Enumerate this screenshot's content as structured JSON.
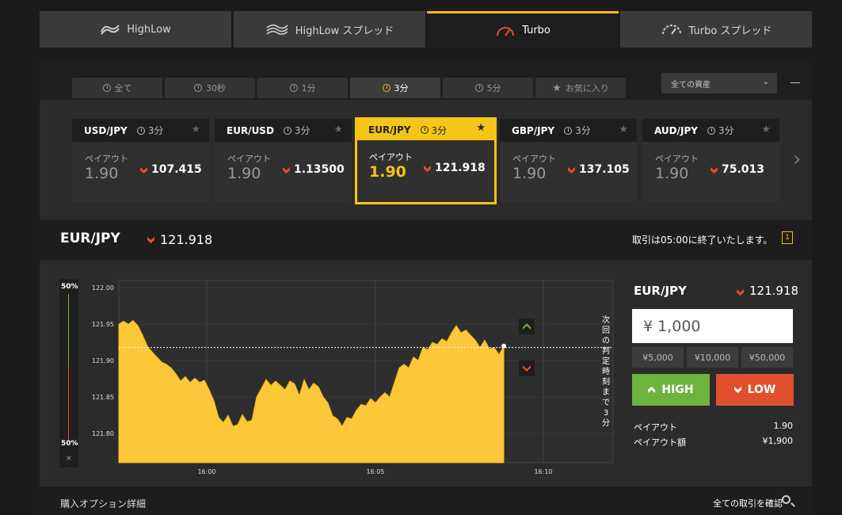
{
  "topnav": {
    "tabs": [
      {
        "label": "HighLow",
        "icon": "highlow-icon"
      },
      {
        "label": "HighLow スプレッド",
        "icon": "highlow-spread-icon"
      },
      {
        "label": "Turbo",
        "icon": "turbo-gauge-icon",
        "active": true
      },
      {
        "label": "Turbo スプレッド",
        "icon": "turbo-spread-gauge-icon"
      }
    ]
  },
  "filters": {
    "tabs": [
      {
        "label": "全て"
      },
      {
        "label": "30秒"
      },
      {
        "label": "1分"
      },
      {
        "label": "3分",
        "active": true
      },
      {
        "label": "5分"
      },
      {
        "label": "お気に入り"
      }
    ],
    "asset_select": "全ての資産"
  },
  "cards": [
    {
      "pair": "USD/JPY",
      "duration": "3分",
      "payout_label": "ペイアウト",
      "payout": "1.90",
      "price": "107.415"
    },
    {
      "pair": "EUR/USD",
      "duration": "3分",
      "payout_label": "ペイアウト",
      "payout": "1.90",
      "price": "1.13500"
    },
    {
      "pair": "EUR/JPY",
      "duration": "3分",
      "payout_label": "ペイアウト",
      "payout": "1.90",
      "price": "121.918"
    },
    {
      "pair": "GBP/JPY",
      "duration": "3分",
      "payout_label": "ペイアウト",
      "payout": "1.90",
      "price": "137.105"
    },
    {
      "pair": "AUD/JPY",
      "duration": "3分",
      "payout_label": "ペイアウト",
      "payout": "1.90",
      "price": "75.013"
    }
  ],
  "tradebar": {
    "pair": "EUR/JPY",
    "price": "121.918",
    "message": "取引は05:00に終了いたします。",
    "badge": "1"
  },
  "sentiment": {
    "high": "50%",
    "low": "50%",
    "close": "×"
  },
  "chart_vertical_text": "次回の判定時刻まで3分",
  "chart_data": {
    "type": "area",
    "xlabel": "",
    "ylabel": "",
    "ylim": [
      121.76,
      122.01
    ],
    "y_ticks": [
      "122.00",
      "121.95",
      "121.90",
      "121.85",
      "121.80"
    ],
    "x_ticks": [
      "16:00",
      "16:05",
      "16:10"
    ],
    "current_rate_line": 121.918,
    "series": [
      {
        "values": [
          121.95,
          121.954,
          121.95,
          121.955,
          121.948,
          121.935,
          121.92,
          121.912,
          121.905,
          121.898,
          121.895,
          121.89,
          121.882,
          121.872,
          121.878,
          121.87,
          121.876,
          121.87,
          121.873,
          121.86,
          121.845,
          121.822,
          121.815,
          121.825,
          121.81,
          121.812,
          121.826,
          121.816,
          121.818,
          121.85,
          121.862,
          121.874,
          121.866,
          121.872,
          121.866,
          121.86,
          121.872,
          121.868,
          121.852,
          121.874,
          121.86,
          121.869,
          121.864,
          121.85,
          121.842,
          121.824,
          121.82,
          121.81,
          121.822,
          121.82,
          121.832,
          121.84,
          121.838,
          121.848,
          121.842,
          121.85,
          121.856,
          121.85,
          121.87,
          121.89,
          121.895,
          121.89,
          121.905,
          121.9,
          121.918,
          121.915,
          121.925,
          121.922,
          121.93,
          121.926,
          121.938,
          121.948,
          121.938,
          121.942,
          121.935,
          121.928,
          121.918,
          121.928,
          121.916,
          121.918,
          121.908,
          121.92
        ]
      }
    ],
    "markers": {
      "high": "high-marker-icon",
      "low": "low-marker-icon"
    }
  },
  "order": {
    "pair": "EUR/JPY",
    "price": "121.918",
    "amount": "¥ 1,000",
    "presets": [
      "¥5,000",
      "¥10,000",
      "¥50,000"
    ],
    "high_label": "HIGH",
    "low_label": "LOW",
    "payout_label": "ペイアウト",
    "payout_value": "1.90",
    "payout_amount_label": "ペイアウト額",
    "payout_amount_value": "¥1,900"
  },
  "bottombar": {
    "title": "購入オプション詳細",
    "link": "全ての取引を確認"
  },
  "colors": {
    "accent": "#f5b81c",
    "high": "#6cb33f",
    "low": "#e0502e",
    "area": "#fdc73a"
  }
}
